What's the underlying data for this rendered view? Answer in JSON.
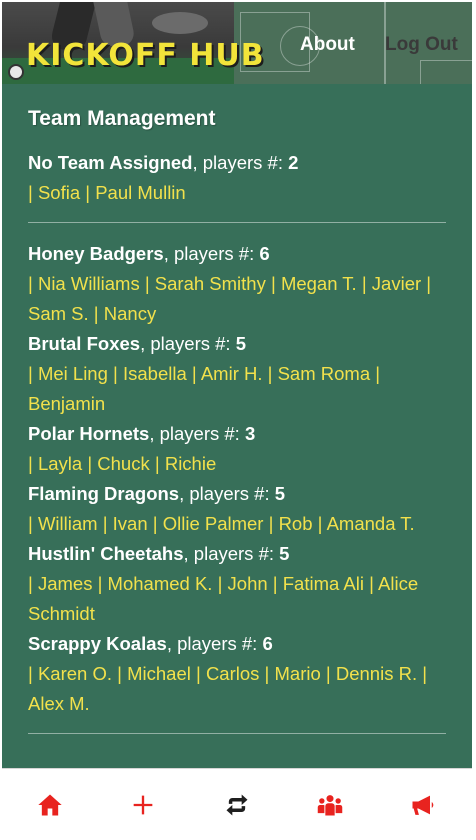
{
  "app": {
    "logo_text": "KICKOFF HUB",
    "nav": {
      "about": "About",
      "logout": "Log Out"
    }
  },
  "page": {
    "title": "Team Management"
  },
  "players_label": ", players #: ",
  "teams": [
    {
      "name": "No Team Assigned",
      "count": "2",
      "players": [
        "Sofia",
        "Paul Mullin"
      ]
    },
    {
      "name": "Honey Badgers",
      "count": "6",
      "players": [
        "Nia Williams",
        "Sarah Smithy",
        "Megan T.",
        "Javier",
        "Sam S.",
        "Nancy"
      ]
    },
    {
      "name": "Brutal Foxes",
      "count": "5",
      "players": [
        "Mei Ling",
        "Isabella",
        "Amir H.",
        "Sam Roma",
        "Benjamin"
      ]
    },
    {
      "name": "Polar Hornets",
      "count": "3",
      "players": [
        "Layla",
        "Chuck",
        "Richie"
      ]
    },
    {
      "name": "Flaming Dragons",
      "count": "5",
      "players": [
        "William",
        "Ivan",
        "Ollie Palmer",
        "Rob",
        "Amanda T."
      ]
    },
    {
      "name": "Hustlin' Cheetahs",
      "count": "5",
      "players": [
        "James",
        "Mohamed K.",
        "John",
        "Fatima Ali",
        "Alice Schmidt"
      ]
    },
    {
      "name": "Scrappy Koalas",
      "count": "6",
      "players": [
        "Karen O.",
        "Michael",
        "Carlos",
        "Mario",
        "Dennis R.",
        "Alex M."
      ]
    }
  ],
  "tabbar": [
    {
      "icon": "home-icon"
    },
    {
      "icon": "plus-icon"
    },
    {
      "icon": "swap-icon"
    },
    {
      "icon": "users-icon"
    },
    {
      "icon": "megaphone-icon"
    }
  ],
  "colors": {
    "header_bg": "#3d6b52",
    "content_bg": "#376f59",
    "logo": "#f2e43a",
    "player_link": "#f2e14c",
    "tab_icon": "#e8231f"
  }
}
